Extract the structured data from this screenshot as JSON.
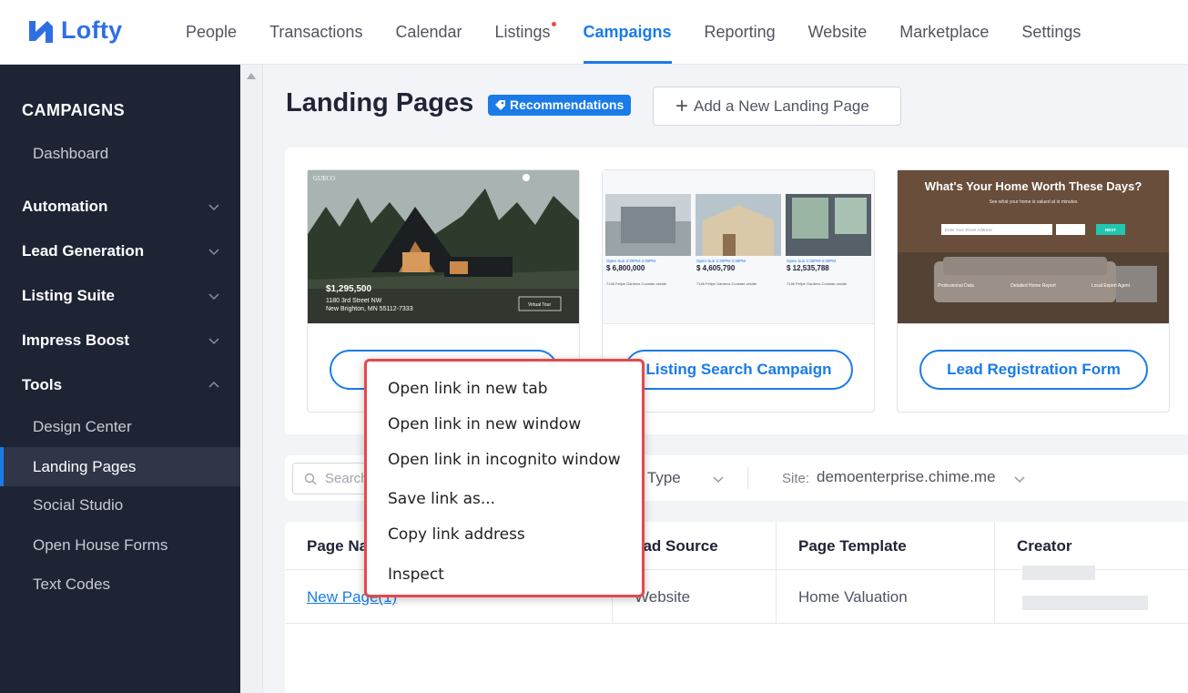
{
  "app": {
    "brand": "Lofty",
    "accent": "#1a7be8"
  },
  "nav": {
    "items": [
      {
        "label": "People"
      },
      {
        "label": "Transactions"
      },
      {
        "label": "Calendar"
      },
      {
        "label": "Listings",
        "notification_dot": true
      },
      {
        "label": "Campaigns",
        "active": true
      },
      {
        "label": "Reporting"
      },
      {
        "label": "Website"
      },
      {
        "label": "Marketplace"
      },
      {
        "label": "Settings"
      }
    ]
  },
  "sidebar": {
    "title": "CAMPAIGNS",
    "dashboard": "Dashboard",
    "groups": [
      {
        "label": "Automation",
        "expanded": false
      },
      {
        "label": "Lead Generation",
        "expanded": false
      },
      {
        "label": "Listing Suite",
        "expanded": false
      },
      {
        "label": "Impress Boost",
        "expanded": false
      },
      {
        "label": "Tools",
        "expanded": true
      }
    ],
    "tools_items": [
      {
        "label": "Design Center"
      },
      {
        "label": "Landing Pages",
        "active": true
      },
      {
        "label": "Social Studio"
      },
      {
        "label": "Open House Forms"
      },
      {
        "label": "Text Codes"
      }
    ]
  },
  "header": {
    "title": "Landing Pages",
    "badge": "Recommendations",
    "add_button": "Add a New Landing Page"
  },
  "templates": {
    "cards": [
      {
        "button": "",
        "preview": {
          "logo": "GUECO",
          "price": "$1,295,500",
          "address1": "1180 3rd Street NW",
          "address2": "New Brighton, MN 55112-7333",
          "tour": "Virtual Tour"
        }
      },
      {
        "button": "Listing Search Campaign",
        "preview": {
          "listings": [
            {
              "open": "Open Sun 2:30PM-4:30PM",
              "price": "$ 6,800,000",
              "addr": "7146 Felipe Gardens Constan-ceside"
            },
            {
              "open": "Open Sun 2:30PM-4:30PM",
              "price": "$ 4,605,790",
              "addr": "7146 Felipe Gardens Constan-ceside"
            },
            {
              "open": "Open Sun 2:30PM-4:30PM",
              "price": "$ 12,535,788",
              "addr": "7146 Felipe Gardens Constan-ceside"
            }
          ]
        }
      },
      {
        "button": "Lead Registration Form",
        "preview": {
          "headline": "What's Your Home Worth These Days?",
          "sub": "See what your home is valued at in minutes",
          "field": "Enter Your Street Address",
          "next": "NEXT",
          "features": [
            "Professional Data",
            "Detailed Home Report",
            "Local Expert Agent"
          ]
        }
      }
    ]
  },
  "filters": {
    "search_placeholder": "Search",
    "type_label": "e Type",
    "site_label": "Site:",
    "site_value": "demoenterprise.chime.me"
  },
  "table": {
    "headers": [
      "Page Na",
      "ead Source",
      "Page Template",
      "Creator"
    ],
    "rows": [
      {
        "page_name": "New Page(1)",
        "lead_source": "Website",
        "template": "Home Valuation"
      }
    ]
  },
  "context_menu": {
    "items": [
      "Open link in new tab",
      "Open link in new window",
      "Open link in incognito window",
      "Save link as...",
      "Copy link address",
      "Inspect"
    ]
  }
}
